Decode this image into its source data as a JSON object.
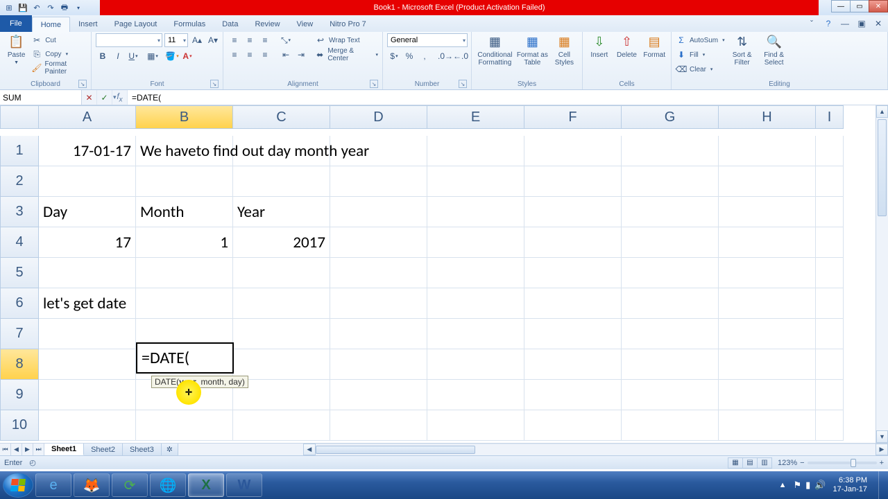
{
  "title": "Book1 - Microsoft Excel (Product Activation Failed)",
  "tabs": {
    "file": "File",
    "home": "Home",
    "insert": "Insert",
    "page_layout": "Page Layout",
    "formulas": "Formulas",
    "data": "Data",
    "review": "Review",
    "view": "View",
    "nitro": "Nitro Pro 7"
  },
  "ribbon": {
    "clipboard": {
      "paste": "Paste",
      "cut": "Cut",
      "copy": "Copy",
      "format_painter": "Format Painter",
      "label": "Clipboard"
    },
    "font": {
      "size": "11",
      "label": "Font"
    },
    "alignment": {
      "wrap": "Wrap Text",
      "merge": "Merge & Center",
      "label": "Alignment"
    },
    "number": {
      "format": "General",
      "label": "Number"
    },
    "styles": {
      "cond": "Conditional Formatting",
      "table": "Format as Table",
      "cell": "Cell Styles",
      "label": "Styles"
    },
    "cells": {
      "insert": "Insert",
      "delete": "Delete",
      "format": "Format",
      "label": "Cells"
    },
    "editing": {
      "autosum": "AutoSum",
      "fill": "Fill",
      "clear": "Clear",
      "sort": "Sort & Filter",
      "find": "Find & Select",
      "label": "Editing"
    }
  },
  "namebox": "SUM",
  "formula": "=DATE(",
  "columns": [
    "A",
    "B",
    "C",
    "D",
    "E",
    "F",
    "G",
    "H",
    "I"
  ],
  "rows": [
    "1",
    "2",
    "3",
    "4",
    "5",
    "6",
    "7",
    "8",
    "9",
    "10"
  ],
  "cells": {
    "A1": "17-01-17",
    "B1": "We haveto find out day month year",
    "A3": "Day",
    "B3": "Month",
    "C3": "Year",
    "A4": "17",
    "B4": "1",
    "C4": "2017",
    "A6": "let's get date",
    "B8": "=DATE("
  },
  "tooltip": {
    "fn": "DATE",
    "arg1": "year",
    "rest": ", month, day)"
  },
  "sheets": {
    "s1": "Sheet1",
    "s2": "Sheet2",
    "s3": "Sheet3"
  },
  "status": {
    "mode": "Enter",
    "zoom": "123%"
  },
  "taskbar": {
    "time": "6:38 PM",
    "date": "17-Jan-17"
  }
}
